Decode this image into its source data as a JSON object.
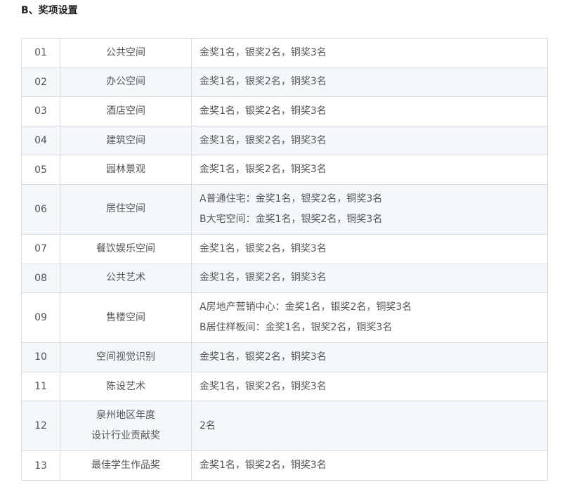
{
  "section_title": "B、奖项设置",
  "rows": [
    {
      "no": "01",
      "category": [
        "公共空间"
      ],
      "awards": [
        "金奖1名，银奖2名，铜奖3名"
      ]
    },
    {
      "no": "02",
      "category": [
        "办公空间"
      ],
      "awards": [
        "金奖1名，银奖2名，铜奖3名"
      ]
    },
    {
      "no": "03",
      "category": [
        "酒店空间"
      ],
      "awards": [
        "金奖1名，银奖2名，铜奖3名"
      ]
    },
    {
      "no": "04",
      "category": [
        "建筑空间"
      ],
      "awards": [
        "金奖1名，银奖2名，铜奖3名"
      ]
    },
    {
      "no": "05",
      "category": [
        "园林景观"
      ],
      "awards": [
        "金奖1名，银奖2名，铜奖3名"
      ]
    },
    {
      "no": "06",
      "category": [
        "居住空间"
      ],
      "awards": [
        "A普通住宅：金奖1名，银奖2名，铜奖3名",
        "B大宅空间：金奖1名，银奖2名，铜奖3名"
      ]
    },
    {
      "no": "07",
      "category": [
        "餐饮娱乐空间"
      ],
      "awards": [
        "金奖1名，银奖2名，铜奖3名"
      ]
    },
    {
      "no": "08",
      "category": [
        "公共艺术"
      ],
      "awards": [
        "金奖1名，银奖2名，铜奖3名"
      ]
    },
    {
      "no": "09",
      "category": [
        "售楼空间"
      ],
      "awards": [
        "A房地产营销中心：金奖1名，银奖2名，铜奖3名",
        "B居住样板间：金奖1名，银奖2名，铜奖3名"
      ]
    },
    {
      "no": "10",
      "category": [
        "空间视觉识别"
      ],
      "awards": [
        "金奖1名，银奖2名，铜奖3名"
      ]
    },
    {
      "no": "11",
      "category": [
        "陈设艺术"
      ],
      "awards": [
        "金奖1名，银奖2名，铜奖3名"
      ]
    },
    {
      "no": "12",
      "category": [
        "泉州地区年度",
        "设计行业贡献奖"
      ],
      "awards": [
        "2名"
      ]
    },
    {
      "no": "13",
      "category": [
        "最佳学生作品奖"
      ],
      "awards": [
        "金奖1名，银奖2名，铜奖3名"
      ]
    }
  ]
}
